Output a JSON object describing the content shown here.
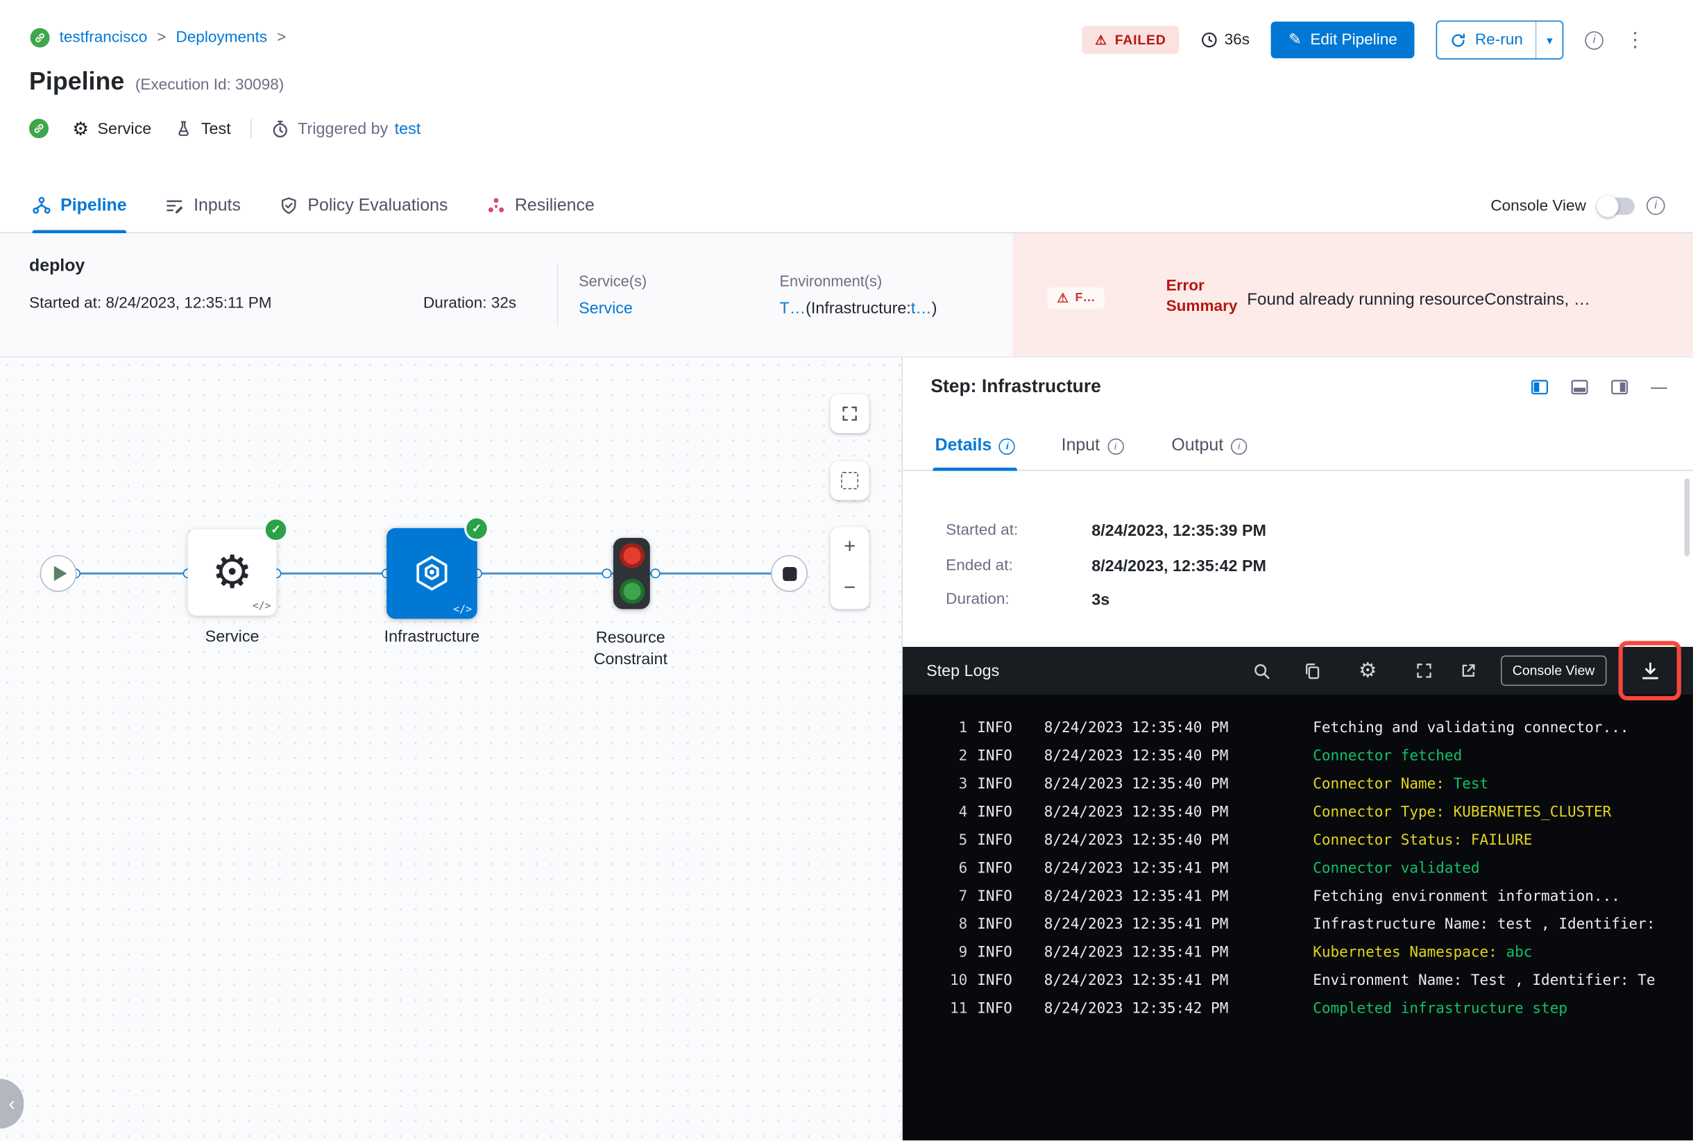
{
  "icons": {
    "gear": "⚙",
    "check": "✓",
    "kebab": "⋮",
    "caret_down": "▾",
    "pencil": "✎",
    "warning": "⚠",
    "plus": "+",
    "minus": "−",
    "code_tag": "</>",
    "chevron_left": "‹",
    "minimize": "—",
    "info": "i"
  },
  "colors": {
    "accent_blue": "#0278d5",
    "failed_red": "#b41710",
    "failed_bg": "#fbe1df",
    "success_green": "#2aa14a",
    "error_bg": "#fcebe9",
    "annotation_red": "#f5473c",
    "log_white": "#eceded",
    "log_green": "#12c06a",
    "log_yellow": "#e4d51e"
  },
  "breadcrumb": {
    "project": "testfrancisco",
    "separator": ">",
    "section": "Deployments"
  },
  "header": {
    "status_badge": "FAILED",
    "elapsed": "36s",
    "edit_button": "Edit Pipeline",
    "rerun_button": "Re-run",
    "title": "Pipeline",
    "execution_id": "(Execution Id: 30098)",
    "service_tag": "Service",
    "test_tag": "Test",
    "triggered_by_label": "Triggered by",
    "triggered_by_value": "test"
  },
  "tabs": {
    "pipeline": "Pipeline",
    "inputs": "Inputs",
    "policy": "Policy Evaluations",
    "resilience": "Resilience",
    "console_view_label": "Console View"
  },
  "summary": {
    "stage_name": "deploy",
    "started": "Started at: 8/24/2023, 12:35:11 PM",
    "duration": "Duration: 32s",
    "services_label": "Service(s)",
    "services_value": "Service",
    "environments_label": "Environment(s)",
    "env_link_1": "T…",
    "env_mid": "(Infrastructure:",
    "env_link_2": "t…",
    "env_end": ")",
    "failed_chip": "F…",
    "error_label": "Error Summary",
    "error_message": "Found already running resourceConstrains, …"
  },
  "canvas": {
    "nodes": {
      "service": "Service",
      "infrastructure": "Infrastructure",
      "resource_constraint": "Resource Constraint"
    }
  },
  "step_panel": {
    "title": "Step: Infrastructure",
    "tab_details": "Details",
    "tab_input": "Input",
    "tab_output": "Output",
    "started_label": "Started at:",
    "started_value": "8/24/2023, 12:35:39 PM",
    "ended_label": "Ended at:",
    "ended_value": "8/24/2023, 12:35:42 PM",
    "duration_label": "Duration:",
    "duration_value": "3s"
  },
  "logs": {
    "title": "Step Logs",
    "console_view_button": "Console View",
    "lines": [
      {
        "num": "1",
        "level": "INFO",
        "time": "8/24/2023 12:35:40 PM",
        "segments": [
          {
            "text": "Fetching and validating connector...",
            "color": "white"
          }
        ]
      },
      {
        "num": "2",
        "level": "INFO",
        "time": "8/24/2023 12:35:40 PM",
        "segments": [
          {
            "text": "Connector fetched",
            "color": "green"
          }
        ]
      },
      {
        "num": "3",
        "level": "INFO",
        "time": "8/24/2023 12:35:40 PM",
        "segments": [
          {
            "text": "Connector Name: ",
            "color": "yellow"
          },
          {
            "text": "Test",
            "color": "green"
          }
        ]
      },
      {
        "num": "4",
        "level": "INFO",
        "time": "8/24/2023 12:35:40 PM",
        "segments": [
          {
            "text": "Connector Type: ",
            "color": "yellow"
          },
          {
            "text": "KUBERNETES_CLUSTER",
            "color": "yellow"
          }
        ]
      },
      {
        "num": "5",
        "level": "INFO",
        "time": "8/24/2023 12:35:40 PM",
        "segments": [
          {
            "text": "Connector Status: ",
            "color": "yellow"
          },
          {
            "text": "FAILURE",
            "color": "yellow"
          }
        ]
      },
      {
        "num": "6",
        "level": "INFO",
        "time": "8/24/2023 12:35:41 PM",
        "segments": [
          {
            "text": "Connector validated",
            "color": "green"
          }
        ]
      },
      {
        "num": "7",
        "level": "INFO",
        "time": "8/24/2023 12:35:41 PM",
        "segments": [
          {
            "text": "Fetching environment information...",
            "color": "white"
          }
        ]
      },
      {
        "num": "8",
        "level": "INFO",
        "time": "8/24/2023 12:35:41 PM",
        "segments": [
          {
            "text": "Infrastructure Name: test , Identifier:",
            "color": "white"
          }
        ]
      },
      {
        "num": "9",
        "level": "INFO",
        "time": "8/24/2023 12:35:41 PM",
        "segments": [
          {
            "text": "Kubernetes Namespace: ",
            "color": "yellow"
          },
          {
            "text": "abc",
            "color": "green"
          }
        ]
      },
      {
        "num": "10",
        "level": "INFO",
        "time": "8/24/2023 12:35:41 PM",
        "segments": [
          {
            "text": "Environment Name: Test , Identifier: Te",
            "color": "white"
          }
        ]
      },
      {
        "num": "11",
        "level": "INFO",
        "time": "8/24/2023 12:35:42 PM",
        "segments": [
          {
            "text": "Completed infrastructure step",
            "color": "green"
          }
        ]
      }
    ]
  }
}
